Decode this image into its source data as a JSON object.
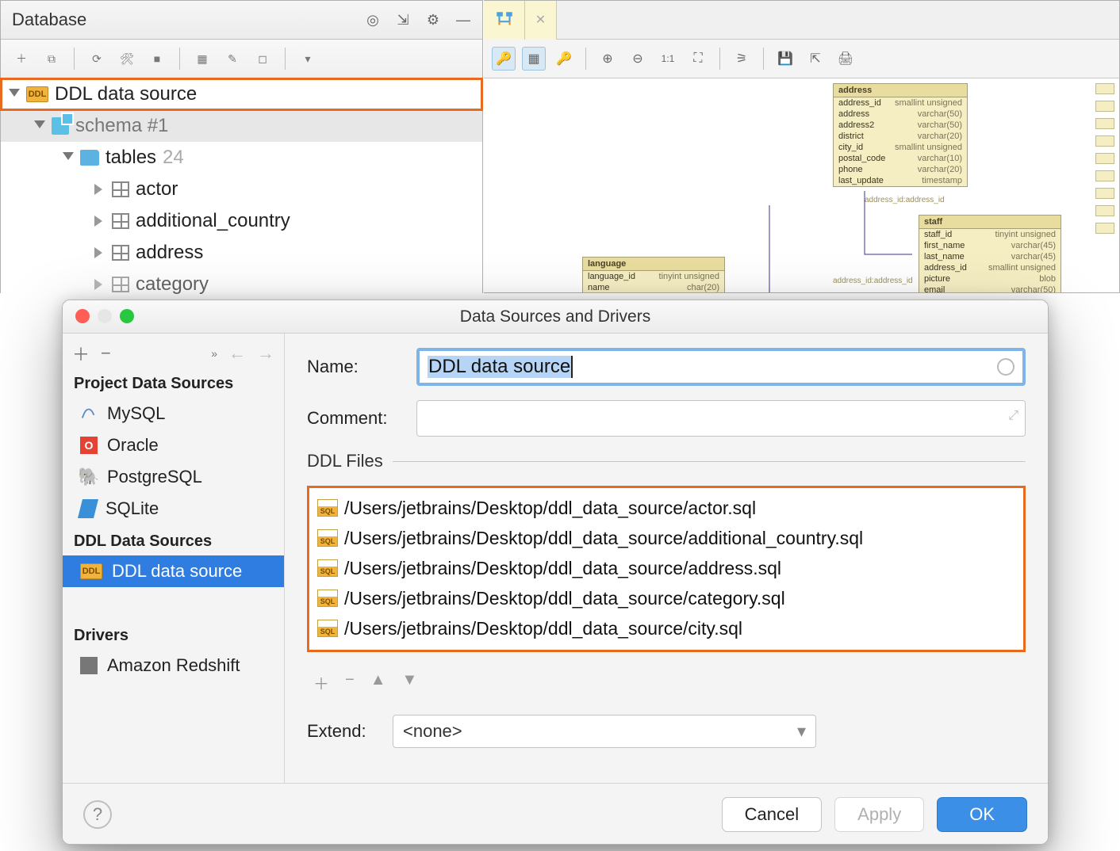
{
  "toolWindow": {
    "title": "Database"
  },
  "tree": {
    "root": "DDL data source",
    "schema": "schema #1",
    "tablesLabel": "tables",
    "tablesCount": "24",
    "tables": [
      "actor",
      "additional_country",
      "address",
      "category"
    ]
  },
  "erd": {
    "address": {
      "title": "address",
      "cols": [
        [
          "address_id",
          "smallint unsigned"
        ],
        [
          "address",
          "varchar(50)"
        ],
        [
          "address2",
          "varchar(50)"
        ],
        [
          "district",
          "varchar(20)"
        ],
        [
          "city_id",
          "smallint unsigned"
        ],
        [
          "postal_code",
          "varchar(10)"
        ],
        [
          "phone",
          "varchar(20)"
        ],
        [
          "last_update",
          "timestamp"
        ]
      ],
      "fk": "address_id:address_id"
    },
    "staff": {
      "title": "staff",
      "cols": [
        [
          "staff_id",
          "tinyint unsigned"
        ],
        [
          "first_name",
          "varchar(45)"
        ],
        [
          "last_name",
          "varchar(45)"
        ],
        [
          "address_id",
          "smallint unsigned"
        ],
        [
          "picture",
          "blob"
        ],
        [
          "email",
          "varchar(50)"
        ]
      ],
      "fk": "address_id:address_id"
    },
    "language": {
      "title": "language",
      "cols": [
        [
          "language_id",
          "tinyint unsigned"
        ],
        [
          "name",
          "char(20)"
        ]
      ]
    }
  },
  "dialog": {
    "title": "Data Sources and Drivers",
    "left": {
      "projectHead": "Project Data Sources",
      "project": [
        "MySQL",
        "Oracle",
        "PostgreSQL",
        "SQLite"
      ],
      "ddlHead": "DDL Data Sources",
      "ddl": [
        "DDL data source"
      ],
      "driversHead": "Drivers",
      "drivers": [
        "Amazon Redshift"
      ]
    },
    "nameLabel": "Name:",
    "nameValue": "DDL data source",
    "commentLabel": "Comment:",
    "filesLabel": "DDL Files",
    "files": [
      "/Users/jetbrains/Desktop/ddl_data_source/actor.sql",
      "/Users/jetbrains/Desktop/ddl_data_source/additional_country.sql",
      "/Users/jetbrains/Desktop/ddl_data_source/address.sql",
      "/Users/jetbrains/Desktop/ddl_data_source/category.sql",
      "/Users/jetbrains/Desktop/ddl_data_source/city.sql"
    ],
    "extendLabel": "Extend:",
    "extendValue": "<none>",
    "buttons": {
      "cancel": "Cancel",
      "apply": "Apply",
      "ok": "OK"
    }
  }
}
